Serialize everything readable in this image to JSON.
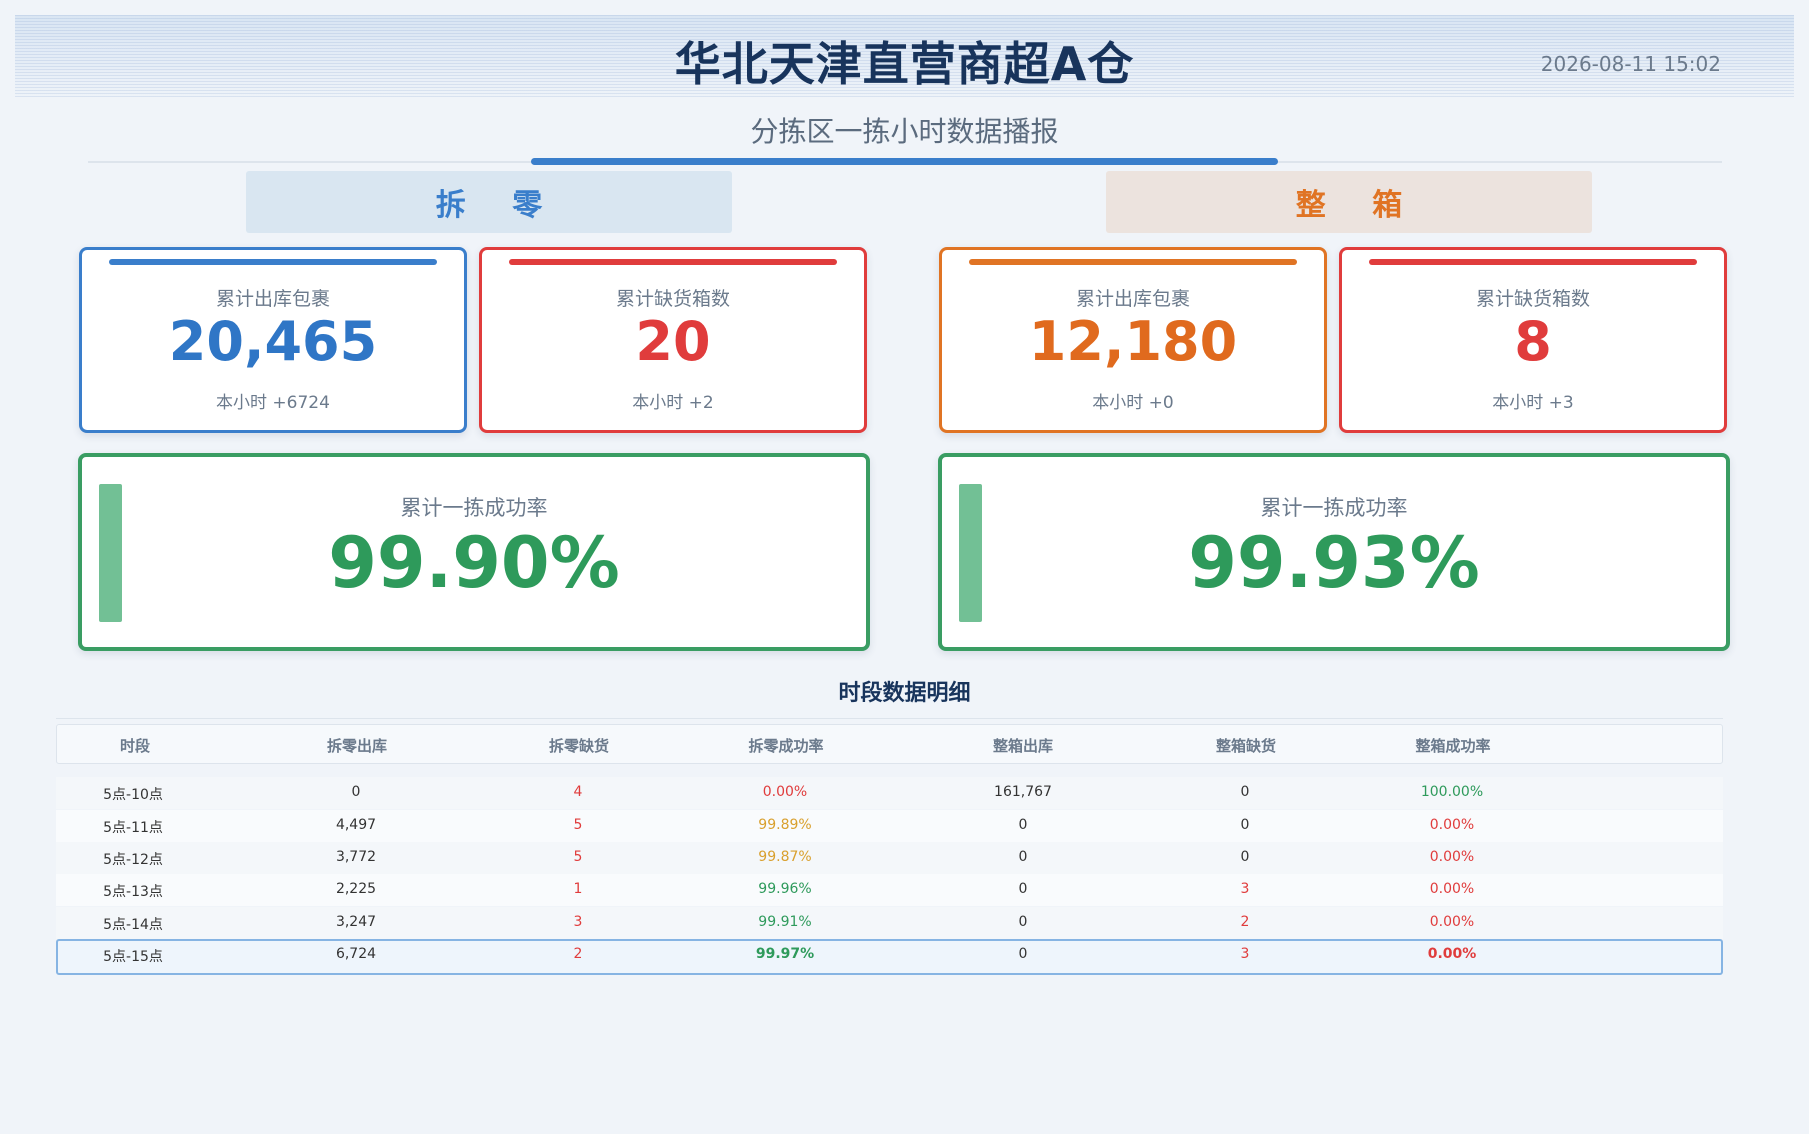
{
  "header": {
    "title": "华北天津直营商超A仓",
    "datetime": "2026-08-11 15:02",
    "subtitle": "分拣区一拣小时数据播报"
  },
  "colors": {
    "primary_blue": "#3a7ecb",
    "alert_red": "#e03c3c",
    "box_orange": "#e07424",
    "success_green": "#2e9a5b"
  },
  "split": {
    "label": "拆 零",
    "outbound": {
      "label": "累计出库包裹",
      "value": "20,465",
      "hour": "本小时 +6724"
    },
    "shortage": {
      "label": "累计缺货箱数",
      "value": "20",
      "hour": "本小时 +2"
    },
    "rate": {
      "label": "累计一拣成功率",
      "value": "99.90%"
    }
  },
  "box": {
    "label": "整 箱",
    "outbound": {
      "label": "累计出库包裹",
      "value": "12,180",
      "hour": "本小时 +0"
    },
    "shortage": {
      "label": "累计缺货箱数",
      "value": "8",
      "hour": "本小时 +3"
    },
    "rate": {
      "label": "累计一拣成功率",
      "value": "99.93%"
    }
  },
  "table": {
    "title": "时段数据明细",
    "columns": [
      "时段",
      "拆零出库",
      "拆零缺货",
      "拆零成功率",
      "整箱出库",
      "整箱缺货",
      "整箱成功率"
    ],
    "rows": [
      [
        "5点-10点",
        "0",
        "4",
        "0.00%",
        "161,767",
        "0",
        "100.00%"
      ],
      [
        "5点-11点",
        "4,497",
        "5",
        "99.89%",
        "0",
        "0",
        "0.00%"
      ],
      [
        "5点-12点",
        "3,772",
        "5",
        "99.87%",
        "0",
        "0",
        "0.00%"
      ],
      [
        "5点-13点",
        "2,225",
        "1",
        "99.96%",
        "0",
        "3",
        "0.00%"
      ],
      [
        "5点-14点",
        "3,247",
        "3",
        "99.91%",
        "0",
        "2",
        "0.00%"
      ],
      [
        "5点-15点",
        "6,724",
        "2",
        "99.97%",
        "0",
        "3",
        "0.00%"
      ]
    ]
  }
}
